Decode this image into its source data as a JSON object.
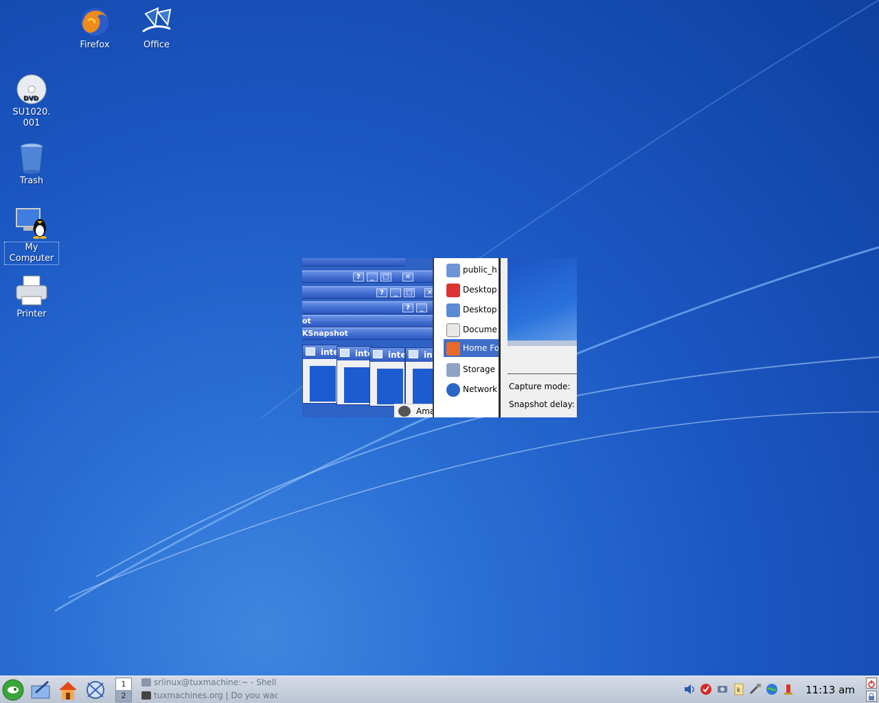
{
  "desktop": {
    "icons": [
      {
        "label": "Firefox",
        "icon": "firefox-icon"
      },
      {
        "label": "Office",
        "icon": "office-icon"
      },
      {
        "label": "SU1020.\n001",
        "line1": "SU1020.",
        "line2": "001",
        "icon": "dvd-icon"
      },
      {
        "label": "Trash",
        "icon": "trash-icon"
      },
      {
        "label": "My Computer",
        "line1": "My",
        "line2": "Computer",
        "icon": "my-computer-icon"
      },
      {
        "label": "Printer",
        "icon": "printer-icon"
      }
    ]
  },
  "preview": {
    "strip_texts": [
      "ot",
      "KSnapshot"
    ],
    "mini_window_title": "inte",
    "mini_window_titles": [
      "inte",
      "inte",
      "inte",
      "in"
    ],
    "places": [
      {
        "label": "public_h",
        "icon": "folder-web-icon"
      },
      {
        "label": "Desktop",
        "icon": "desktop-suse-icon"
      },
      {
        "label": "Desktop",
        "icon": "desktop-icon"
      },
      {
        "label": "Docume",
        "icon": "documents-icon"
      },
      {
        "label": "Home Fo",
        "icon": "home-icon",
        "selected": true
      },
      {
        "label": "Storage M",
        "icon": "storage-icon"
      },
      {
        "label": "Network",
        "icon": "network-icon"
      }
    ],
    "capture_mode_label": "Capture mode:",
    "snapshot_delay_label": "Snapshot delay:",
    "menu_item": "Ama",
    "button_glyphs": {
      "help": "?",
      "minimize": "_",
      "maximize": "□",
      "close": "✕"
    }
  },
  "taskbar": {
    "pager": [
      "1",
      "2"
    ],
    "tasks": [
      {
        "label": "srlinux@tuxmachine:~ - Shell -",
        "icon": "terminal-icon"
      },
      {
        "label": "tuxmachines.org | Do you wadd",
        "icon": "tux-icon"
      }
    ],
    "clock": "11:13 am",
    "colors": {
      "accent": "#2a6fd4",
      "taskbar": "#c9d0dd"
    }
  }
}
